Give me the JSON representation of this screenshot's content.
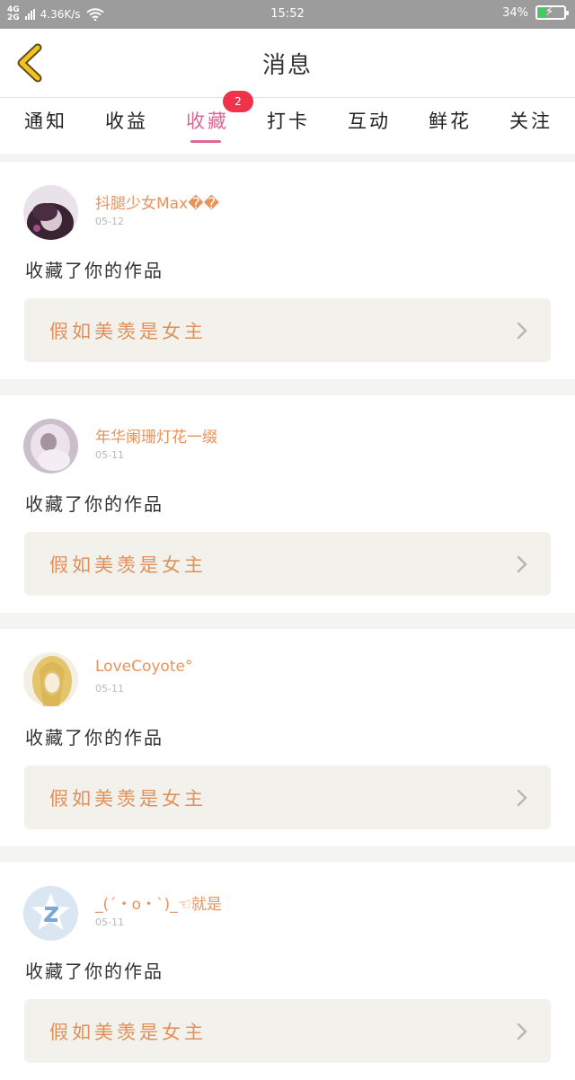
{
  "status_bar": {
    "network_top": "4G",
    "network_bottom": "2G",
    "speed": "4.36K/s",
    "time": "15:52",
    "battery_percent_text": "34%",
    "battery_level": 0.34,
    "battery_color": "#3ccf5a"
  },
  "header": {
    "title": "消息",
    "back_icon": "chevron-left-icon",
    "back_icon_color": "#f2c321"
  },
  "tabs": {
    "items": [
      "通知",
      "收益",
      "收藏",
      "打卡",
      "互动",
      "鲜花",
      "关注"
    ],
    "active_index": 2,
    "active_color": "#e06693",
    "badge_count": "2",
    "badge_color": "#f0324b"
  },
  "messages": [
    {
      "username": "抖腿少女Max��",
      "date": "05-12",
      "action": "收藏了你的作品",
      "work_title": "假如美羡是女主",
      "avatar": "avatar-dark-hair"
    },
    {
      "username": "年华阑珊灯花一缀",
      "date": "05-11",
      "action": "收藏了你的作品",
      "work_title": "假如美羡是女主",
      "avatar": "avatar-lavender"
    },
    {
      "username": "LoveCoyote°",
      "date": "05-11",
      "action": "收藏了你的作品",
      "work_title": "假如美羡是女主",
      "avatar": "avatar-blonde"
    },
    {
      "username": "_(´・ο・`)_☜就是",
      "date": "05-11",
      "action": "收藏了你的作品",
      "work_title": "假如美羡是女主",
      "avatar": "avatar-default-star"
    }
  ],
  "colors": {
    "username": "#e8925c",
    "work_title": "#e0915b",
    "work_bg": "#f2f1eb"
  }
}
